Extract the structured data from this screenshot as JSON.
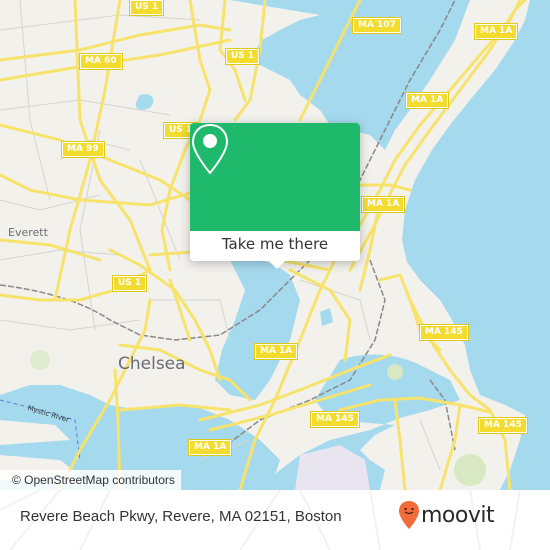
{
  "map": {
    "route_shields": [
      {
        "id": "us1-top",
        "label": "US 1"
      },
      {
        "id": "ma60",
        "label": "MA 60"
      },
      {
        "id": "us1-mid",
        "label": "US 1"
      },
      {
        "id": "ma99",
        "label": "MA 99"
      },
      {
        "id": "ma107",
        "label": "MA 107"
      },
      {
        "id": "ma1a-top",
        "label": "MA 1A"
      },
      {
        "id": "ma1a-upper",
        "label": "MA 1A"
      },
      {
        "id": "ma1a-mid",
        "label": "MA 1A"
      },
      {
        "id": "us1-low",
        "label": "US 1"
      },
      {
        "id": "ma145-right",
        "label": "MA 145"
      },
      {
        "id": "ma1a-center",
        "label": "MA 1A"
      },
      {
        "id": "ma145-center",
        "label": "MA 145"
      },
      {
        "id": "ma145-far",
        "label": "MA 145"
      },
      {
        "id": "ma1a-low",
        "label": "MA 1A"
      }
    ],
    "places": {
      "everett": "Everett",
      "chelsea": "Chelsea",
      "mystic_river": "Mystic River"
    },
    "attribution": "© OpenStreetMap contributors",
    "colors": {
      "land": "#f2f1ec",
      "water": "#a5d9ee",
      "road": "#f7e36b",
      "shield": "#f3dc2e"
    }
  },
  "popup": {
    "icon": "map-pin-icon",
    "button_label": "Take me there",
    "color": "#1eb96a"
  },
  "footer": {
    "address": "Revere Beach Pkwy, Revere, MA 02151, Boston",
    "brand": "moovit",
    "brand_color": "#f26b3a"
  }
}
